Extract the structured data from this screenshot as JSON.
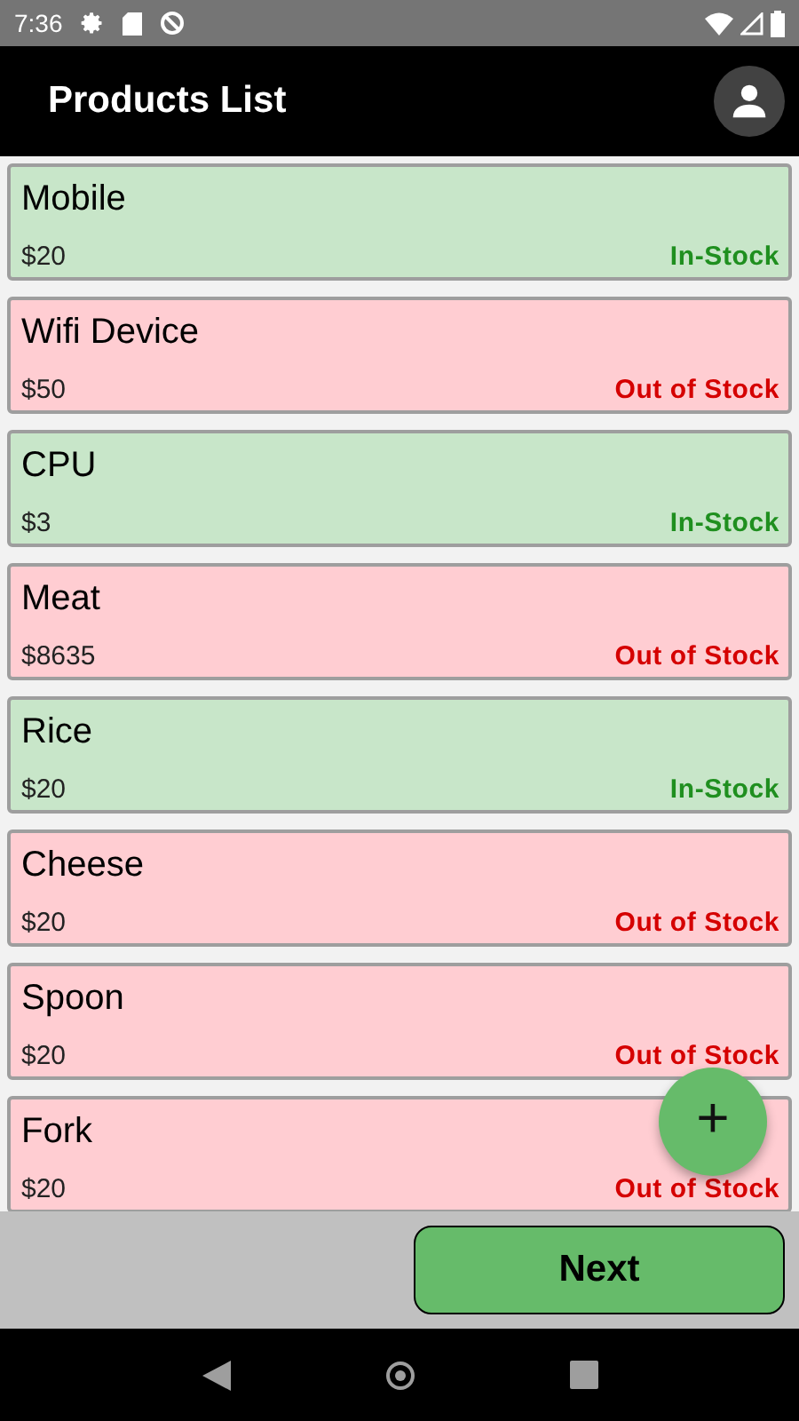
{
  "status_bar": {
    "time": "7:36"
  },
  "app_bar": {
    "title": "Products List"
  },
  "products": [
    {
      "name": "Mobile",
      "price": "$20",
      "stock": "In-Stock",
      "in_stock": true
    },
    {
      "name": "Wifi Device",
      "price": "$50",
      "stock": "Out of Stock",
      "in_stock": false
    },
    {
      "name": "CPU",
      "price": "$3",
      "stock": "In-Stock",
      "in_stock": true
    },
    {
      "name": "Meat",
      "price": "$8635",
      "stock": "Out of Stock",
      "in_stock": false
    },
    {
      "name": "Rice",
      "price": "$20",
      "stock": "In-Stock",
      "in_stock": true
    },
    {
      "name": "Cheese",
      "price": "$20",
      "stock": "Out of Stock",
      "in_stock": false
    },
    {
      "name": "Spoon",
      "price": "$20",
      "stock": "Out of Stock",
      "in_stock": false
    },
    {
      "name": "Fork",
      "price": "$20",
      "stock": "Out of Stock",
      "in_stock": false
    }
  ],
  "fab": {
    "label": "+"
  },
  "next_button": {
    "label": "Next"
  }
}
